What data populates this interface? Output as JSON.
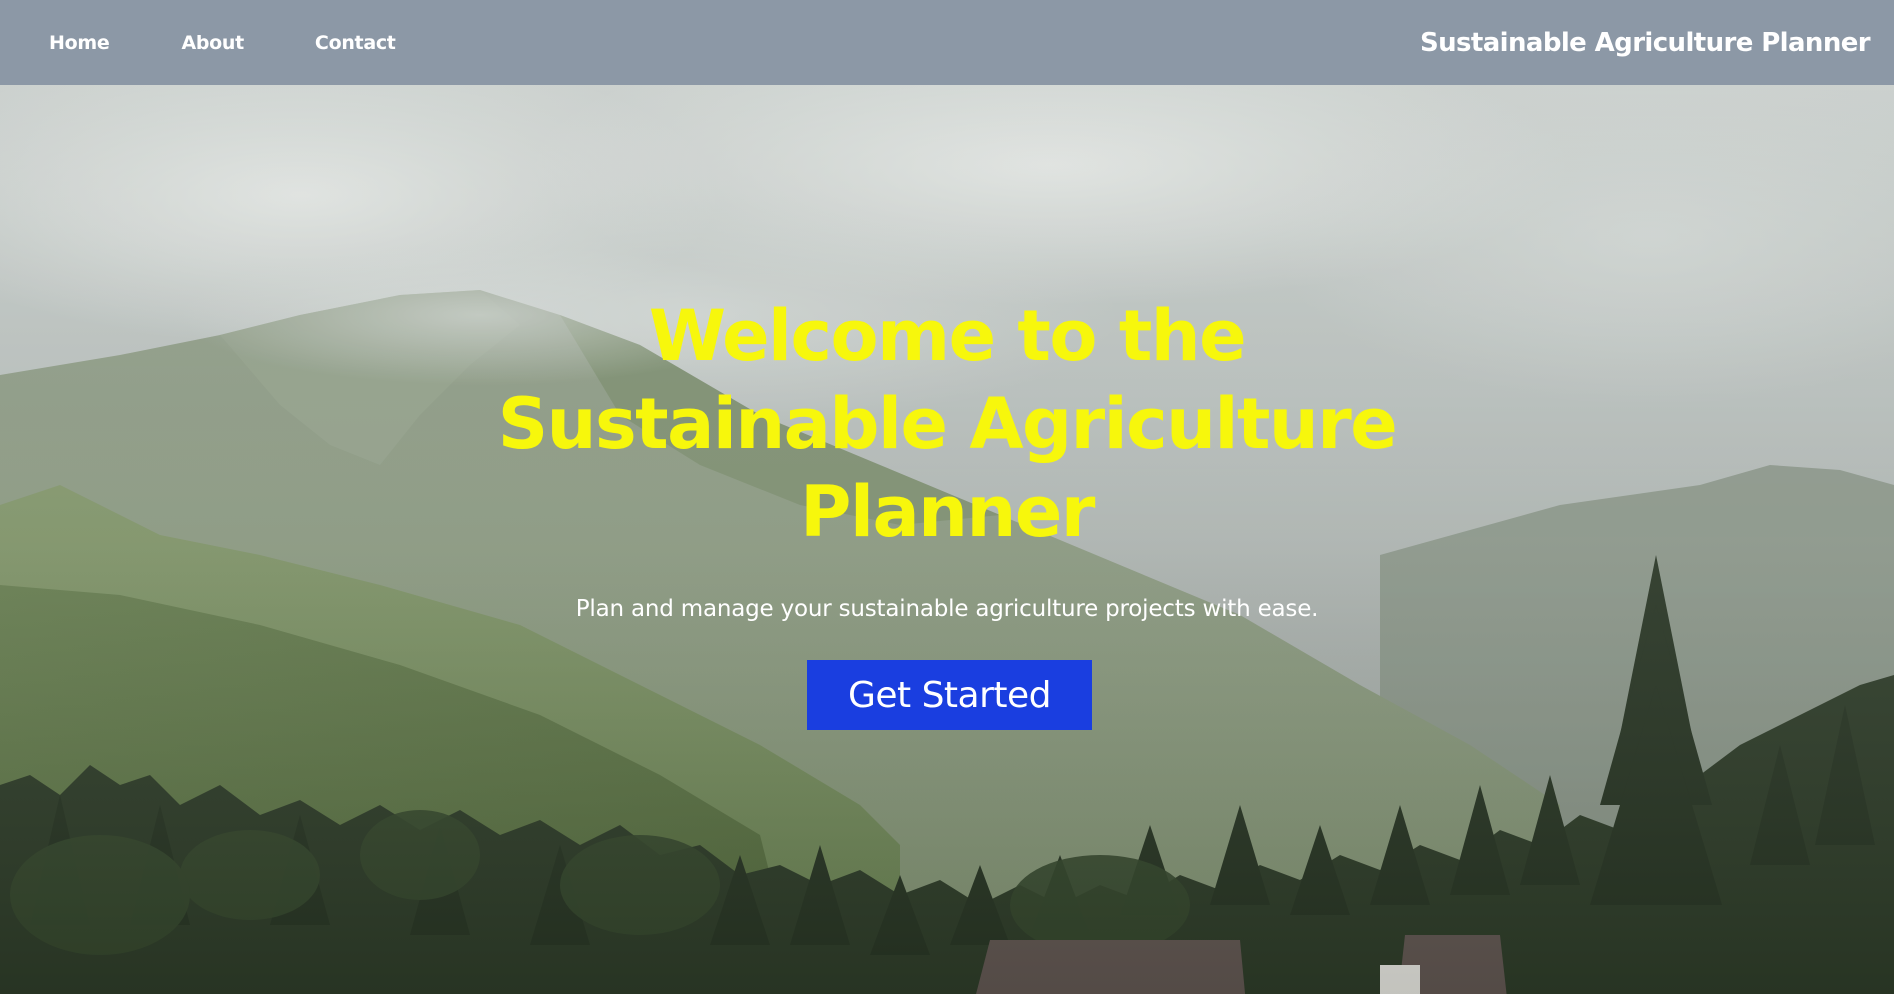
{
  "nav": {
    "links": [
      {
        "label": "Home"
      },
      {
        "label": "About"
      },
      {
        "label": "Contact"
      }
    ],
    "brand": "Sustainable Agriculture Planner"
  },
  "hero": {
    "title": "Welcome to the Sustainable Agriculture Planner",
    "subtitle": "Plan and manage your sustainable agriculture projects with ease.",
    "cta_label": "Get Started"
  },
  "colors": {
    "navbar_bg": "#8c98a6",
    "title": "#f7f70c",
    "cta_bg": "#1a3ee0",
    "text": "#ffffff"
  }
}
